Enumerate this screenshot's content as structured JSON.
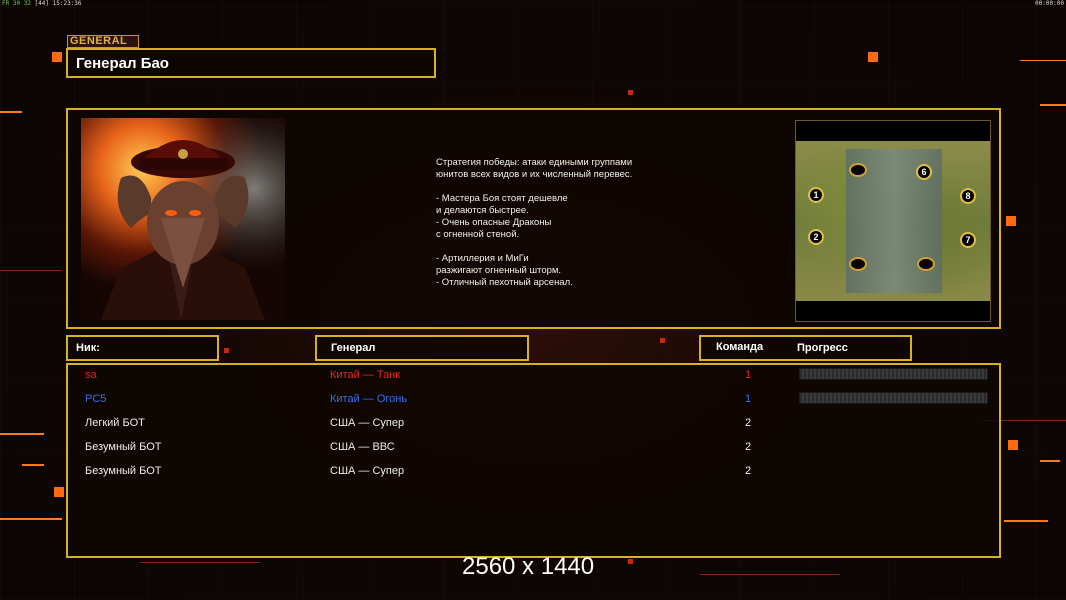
{
  "status": {
    "fps_left": "FR 30",
    "fps_mid": "32",
    "fps_extra": "[44]",
    "clock": "15:23:36",
    "timer": "00:00:00"
  },
  "general": {
    "tab_label": "GENERAL",
    "name": "Генерал Бао",
    "description": [
      "Стратегия победы: атаки едиными группами",
      "юнитов всех видов и их численный перевес.",
      "",
      "- Мастера Боя стоят дешевле",
      "и делаются быстрее.",
      "- Очень опасные Драконы",
      "с огненной стеной.",
      "",
      "- Артиллерия и МиГи",
      "разжигают огненный шторм.",
      "- Отличный пехотный арсенал."
    ]
  },
  "map": {
    "positions": [
      "1",
      "2",
      "6",
      "8",
      "7"
    ]
  },
  "headers": {
    "nick": "Ник:",
    "general": "Генерал",
    "team": "Команда",
    "progress": "Прогресс"
  },
  "players": [
    {
      "nick": "sa",
      "general": "Китай — Танк",
      "team": "1",
      "color": "#e12a22",
      "has_progress": true
    },
    {
      "nick": "PC5",
      "general": "Китай — Огонь",
      "team": "1",
      "color": "#3b6ff0",
      "has_progress": true
    },
    {
      "nick": "Легкий БОТ",
      "general": "США — Супер",
      "team": "2",
      "color": "#ececec",
      "has_progress": false
    },
    {
      "nick": "Безумный БОТ",
      "general": "США — ВВС",
      "team": "2",
      "color": "#ececec",
      "has_progress": false
    },
    {
      "nick": "Безумный БОТ",
      "general": "США — Супер",
      "team": "2",
      "color": "#ececec",
      "has_progress": false
    }
  ],
  "overlay": {
    "resolution": "2560 x 1440"
  },
  "colors": {
    "frame": "#d8b21c",
    "accent": "#ff6a10"
  }
}
